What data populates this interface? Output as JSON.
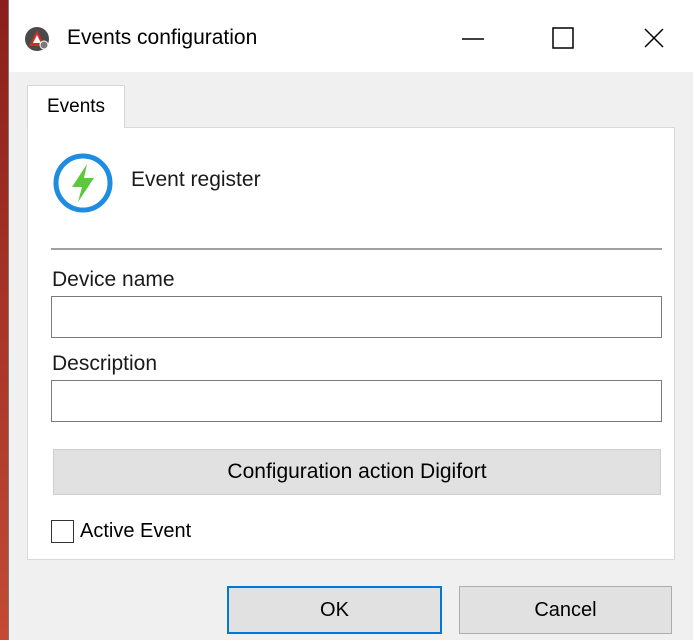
{
  "window": {
    "title": "Events configuration",
    "controls": {
      "minimize": "minimize",
      "maximize": "maximize",
      "close": "close"
    }
  },
  "tabs": [
    {
      "label": "Events",
      "active": true
    }
  ],
  "panel": {
    "heading": "Event register",
    "icon": "lightning-bolt-icon",
    "fields": {
      "device_name": {
        "label": "Device name",
        "value": ""
      },
      "description": {
        "label": "Description",
        "value": ""
      }
    },
    "config_button_label": "Configuration action Digifort",
    "active_event": {
      "label": "Active Event",
      "checked": false
    }
  },
  "buttons": {
    "ok_label": "OK",
    "cancel_label": "Cancel"
  },
  "colors": {
    "accent": "#0078d7",
    "icon_ring": "#1e8ce0",
    "bolt": "#5cc83c",
    "background": "#b63a2c"
  }
}
